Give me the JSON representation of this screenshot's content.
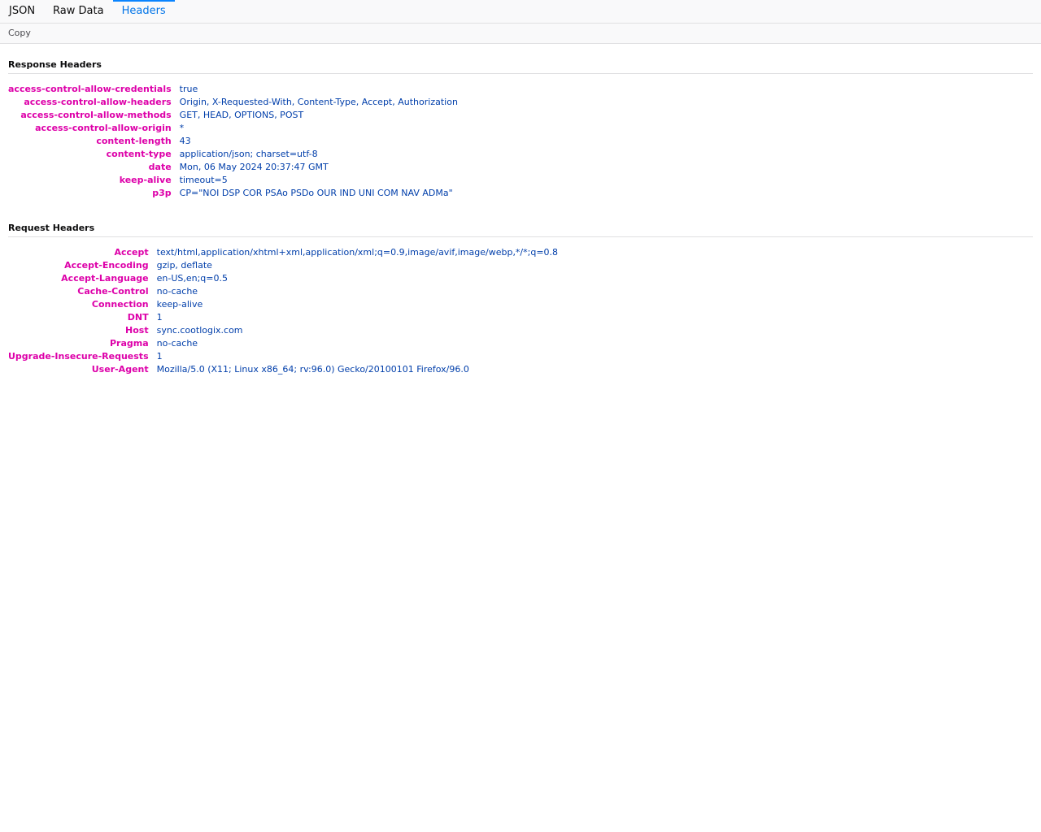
{
  "tabs": {
    "json": "JSON",
    "raw": "Raw Data",
    "headers": "Headers"
  },
  "toolbar": {
    "copy_label": "Copy"
  },
  "response": {
    "title": "Response Headers",
    "rows": [
      {
        "name": "access-control-allow-credentials",
        "value": "true"
      },
      {
        "name": "access-control-allow-headers",
        "value": "Origin, X-Requested-With, Content-Type, Accept, Authorization"
      },
      {
        "name": "access-control-allow-methods",
        "value": "GET, HEAD, OPTIONS, POST"
      },
      {
        "name": "access-control-allow-origin",
        "value": "*"
      },
      {
        "name": "content-length",
        "value": "43"
      },
      {
        "name": "content-type",
        "value": "application/json; charset=utf-8"
      },
      {
        "name": "date",
        "value": "Mon, 06 May 2024 20:37:47 GMT"
      },
      {
        "name": "keep-alive",
        "value": "timeout=5"
      },
      {
        "name": "p3p",
        "value": "CP=\"NOI DSP COR PSAo PSDo OUR IND UNI COM NAV ADMa\""
      }
    ]
  },
  "request": {
    "title": "Request Headers",
    "rows": [
      {
        "name": "Accept",
        "value": "text/html,application/xhtml+xml,application/xml;q=0.9,image/avif,image/webp,*/*;q=0.8"
      },
      {
        "name": "Accept-Encoding",
        "value": "gzip, deflate"
      },
      {
        "name": "Accept-Language",
        "value": "en-US,en;q=0.5"
      },
      {
        "name": "Cache-Control",
        "value": "no-cache"
      },
      {
        "name": "Connection",
        "value": "keep-alive"
      },
      {
        "name": "DNT",
        "value": "1"
      },
      {
        "name": "Host",
        "value": "sync.cootlogix.com"
      },
      {
        "name": "Pragma",
        "value": "no-cache"
      },
      {
        "name": "Upgrade-Insecure-Requests",
        "value": "1"
      },
      {
        "name": "User-Agent",
        "value": "Mozilla/5.0 (X11; Linux x86_64; rv:96.0) Gecko/20100101 Firefox/96.0"
      }
    ]
  }
}
